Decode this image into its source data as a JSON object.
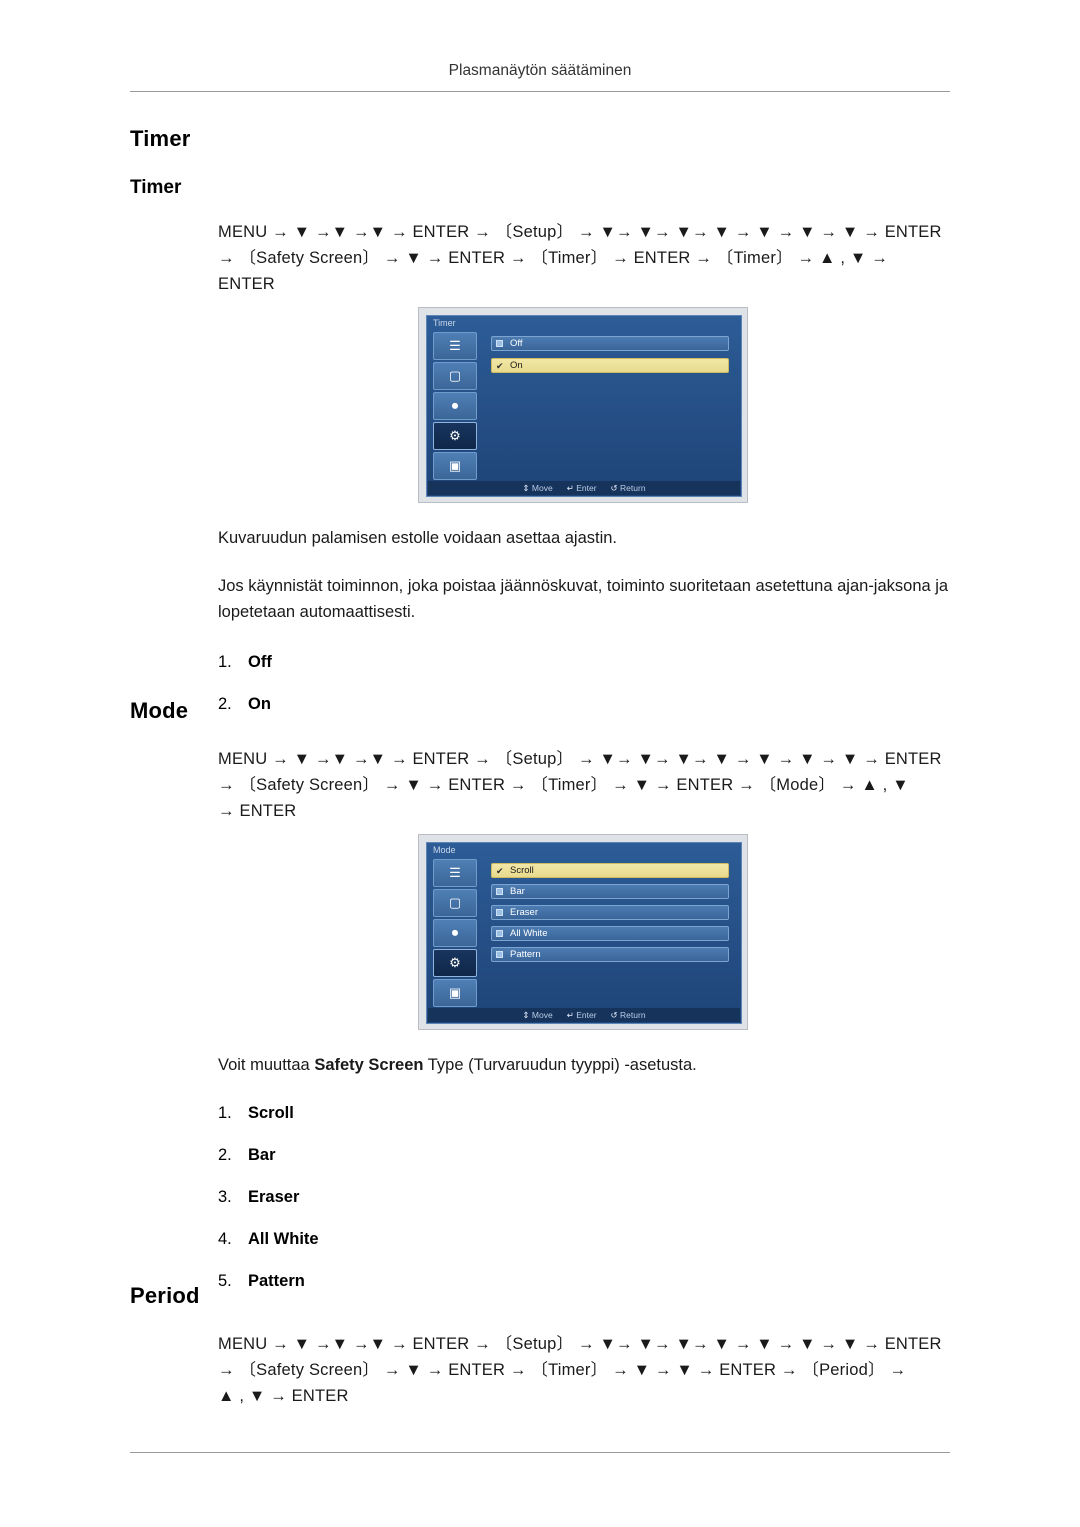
{
  "header": {
    "title": "Plasmanäytön säätäminen"
  },
  "sections": [
    {
      "heading": "Timer",
      "subheading": "Timer",
      "nav_lines": [
        "MENU →  ▼  →▼  →▼  → ENTER →  〔Setup〕  →  ▼→  ▼→  ▼→  ▼  →  ▼  →  ▼  →  ▼  → ENTER",
        "→  〔Safety Screen〕  →  ▼  → ENTER →  〔Timer〕  → ENTER →  〔Timer〕  →  ▲ ,  ▼  →",
        "ENTER"
      ],
      "paragraphs": [
        "Kuvaruudun palamisen estolle voidaan asettaa ajastin.",
        "Jos käynnistät toiminnon, joka poistaa jäännöskuvat, toiminto suoritetaan asetettuna ajan-jaksona ja lopetetaan automaattisesti."
      ],
      "list": [
        {
          "num": "1.",
          "label": "Off"
        },
        {
          "num": "2.",
          "label": "On"
        }
      ],
      "osd": {
        "title": "Timer",
        "rows": [
          {
            "label": "Off",
            "selected": false
          },
          {
            "label": "On",
            "selected": true
          }
        ],
        "footer": [
          {
            "icon": "move-icon",
            "label": "Move"
          },
          {
            "icon": "enter-icon",
            "label": "Enter"
          },
          {
            "icon": "return-icon",
            "label": "Return"
          }
        ]
      }
    },
    {
      "heading": "Mode",
      "subheading": "",
      "nav_lines": [
        "MENU →  ▼  →▼  →▼  → ENTER →  〔Setup〕  →  ▼→  ▼→  ▼→  ▼  →  ▼  →  ▼  →  ▼  → ENTER",
        "→  〔Safety Screen〕  →  ▼  → ENTER →  〔Timer〕  →  ▼  → ENTER →  〔Mode〕  →  ▲ ,  ▼",
        "→ ENTER"
      ],
      "paragraphs": [
        "Voit muuttaa Safety Screen Type (Turvaruudun tyyppi) -asetusta."
      ],
      "list": [
        {
          "num": "1.",
          "label": "Scroll"
        },
        {
          "num": "2.",
          "label": "Bar"
        },
        {
          "num": "3.",
          "label": "Eraser"
        },
        {
          "num": "4.",
          "label": "All White"
        },
        {
          "num": "5.",
          "label": "Pattern"
        }
      ],
      "osd": {
        "title": "Mode",
        "rows": [
          {
            "label": "Scroll",
            "selected": true
          },
          {
            "label": "Bar",
            "selected": false
          },
          {
            "label": "Eraser",
            "selected": false
          },
          {
            "label": "All White",
            "selected": false
          },
          {
            "label": "Pattern",
            "selected": false
          }
        ],
        "footer": [
          {
            "icon": "move-icon",
            "label": "Move"
          },
          {
            "icon": "enter-icon",
            "label": "Enter"
          },
          {
            "icon": "return-icon",
            "label": "Return"
          }
        ]
      }
    },
    {
      "heading": "Period",
      "subheading": "",
      "nav_lines": [
        "MENU →  ▼  →▼  →▼  → ENTER →  〔Setup〕  →  ▼→  ▼→  ▼→  ▼  →  ▼  →  ▼  →  ▼  → ENTER",
        "→  〔Safety Screen〕  →  ▼  → ENTER →  〔Timer〕  →  ▼  →  ▼  → ENTER →  〔Period〕  →",
        "▲ ,  ▼  → ENTER"
      ],
      "paragraphs": [],
      "list": []
    }
  ],
  "osd_text": {
    "timer_paragraph_1": "Kuvaruudun palamisen estolle voidaan asettaa ajastin.",
    "mode_paragraph_prefix": "Voit muuttaa ",
    "mode_paragraph_bold": "Safety Screen",
    "mode_paragraph_suffix": " Type (Turvaruudun tyyppi) -asetusta."
  }
}
